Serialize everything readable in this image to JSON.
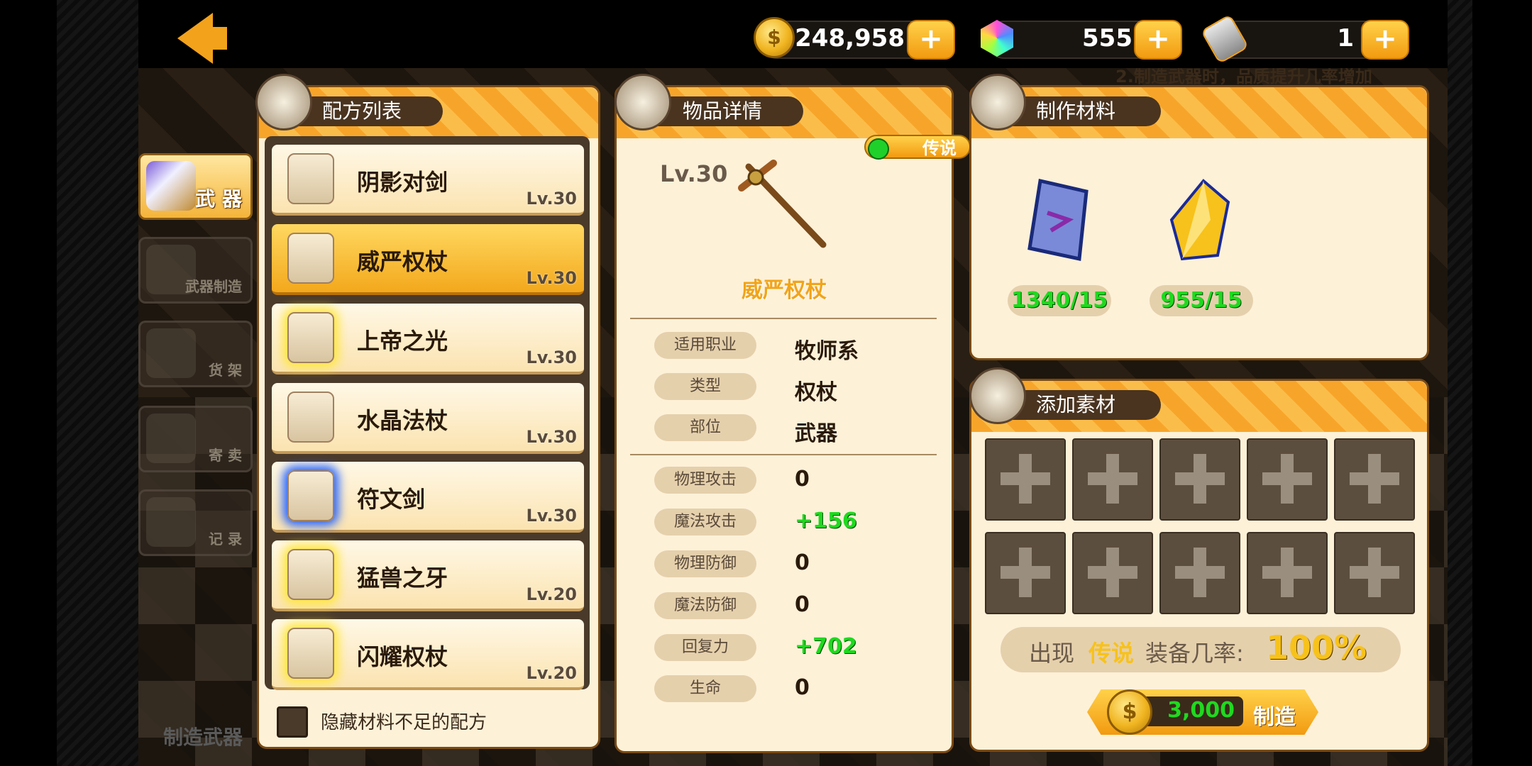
{
  "topbar": {
    "gold": "248,958",
    "gems": "555",
    "hammers": "1",
    "plus_label": "+"
  },
  "tabs": [
    {
      "label": "武 器",
      "active": true
    },
    {
      "label": "武器制造",
      "active": false
    },
    {
      "label": "货 架",
      "active": false
    },
    {
      "label": "寄 卖",
      "active": false
    },
    {
      "label": "记 录",
      "active": false
    }
  ],
  "recipes": {
    "title": "配方列表",
    "items": [
      {
        "name": "阴影对剑",
        "level": "Lv.30"
      },
      {
        "name": "威严权杖",
        "level": "Lv.30"
      },
      {
        "name": "上帝之光",
        "level": "Lv.30"
      },
      {
        "name": "水晶法杖",
        "level": "Lv.30"
      },
      {
        "name": "符文剑",
        "level": "Lv.30"
      },
      {
        "name": "猛兽之牙",
        "level": "Lv.20"
      },
      {
        "name": "闪耀权杖",
        "level": "Lv.20"
      }
    ],
    "selected_index": 1,
    "hide_insufficient_label": "隐藏材料不足的配方"
  },
  "item_detail": {
    "title": "物品详情",
    "rarity": "传说",
    "level": "Lv.30",
    "name": "威严权杖",
    "info": [
      {
        "label": "适用职业",
        "value": "牧师系"
      },
      {
        "label": "类型",
        "value": "权杖"
      },
      {
        "label": "部位",
        "value": "武器"
      }
    ],
    "stats": [
      {
        "label": "物理攻击",
        "value": "0"
      },
      {
        "label": "魔法攻击",
        "value": "+156"
      },
      {
        "label": "物理防御",
        "value": "0"
      },
      {
        "label": "魔法防御",
        "value": "0"
      },
      {
        "label": "回复力",
        "value": "+702"
      },
      {
        "label": "生命",
        "value": "0"
      }
    ]
  },
  "materials": {
    "title": "制作材料",
    "items": [
      {
        "icon": "rune-stone-icon",
        "count": "1340/15"
      },
      {
        "icon": "gold-crystal-icon",
        "count": "955/15"
      }
    ]
  },
  "add_material": {
    "title": "添加素材",
    "chance_prefix": "出现",
    "chance_rarity": "传说",
    "chance_middle": "装备几率:",
    "chance_value": "100%"
  },
  "craft": {
    "cost": "3,000",
    "label": "制造"
  },
  "hints": {
    "bottom": "制造武器",
    "top_right": "2.制造武器时，品质提升几率增加"
  },
  "colors": {
    "accent_orange": "#f3a21b",
    "positive_green": "#1fd91f",
    "legend_gold": "#f7c21b"
  }
}
